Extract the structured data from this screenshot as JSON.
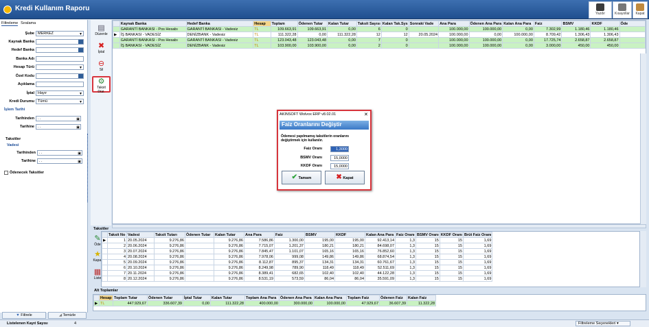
{
  "app": {
    "title": "Kredi Kullanım Raporu",
    "toolbar": {
      "print": "Yazdır",
      "favorites": "Kısayollar",
      "exit": "Kapat"
    }
  },
  "left": {
    "tabs": [
      "Filtreleme",
      "Sıralama"
    ],
    "fields": [
      {
        "label": "Şube",
        "value": "MERKEZ",
        "type": "dropdown"
      },
      {
        "label": "Kaynak Banka",
        "value": "",
        "type": "lookup"
      },
      {
        "label": "Hedef Banka",
        "value": "",
        "type": "lookup"
      },
      {
        "label": "Banka Adı",
        "value": "",
        "type": "text"
      },
      {
        "label": "Hesap Türü",
        "value": "",
        "type": "dropdown"
      },
      {
        "label": "Özel Kodu",
        "value": "",
        "type": "lookup"
      },
      {
        "label": "Açıklama",
        "value": "",
        "type": "text"
      },
      {
        "label": "İptal",
        "value": "Hayır",
        "type": "dropdown"
      },
      {
        "label": "Kredi Durumu",
        "value": "Tümü",
        "type": "dropdown"
      }
    ],
    "islem_tarihi": "İşlem Tarihi",
    "date1": [
      {
        "label": "Tarihinden",
        "value": " . ."
      },
      {
        "label": "Tarihine",
        "value": " . ."
      }
    ],
    "taksitler": "Taksitler",
    "vadesi": "Vadesi",
    "date2": [
      {
        "label": "Tarihinden",
        "value": " . ."
      },
      {
        "label": "Tarihine",
        "value": " . ."
      }
    ],
    "odenecek": "Ödenecek Taksitler",
    "filter_btn": "Filtrele",
    "clear_btn": "Temizle"
  },
  "vtools": [
    "Düzenle",
    "İptal",
    "Sil",
    "Taksit Düz."
  ],
  "grid": {
    "columns": [
      "Kaynak Banka",
      "Hedef Banka",
      "Hesap",
      "Toplam",
      "Ödenen Tutar",
      "Kalan Tutar",
      "Taksit Sayısı",
      "Kalan Tak.Sys",
      "Sonraki Vade",
      "Ana Para",
      "Ödenen Ana Para",
      "Kalan Ana Para",
      "Faiz",
      "BSMV",
      "KKDF",
      "Öde"
    ],
    "rows": [
      {
        "c": [
          "GARANTİ BANKASI - Pos Hesabı",
          "GARANTİ BANKASI - Vadesiz",
          "TL",
          "109.663,91",
          "109.663,91",
          "0,00",
          "6",
          "0",
          "",
          "100.000,00",
          "100.000,00",
          "0,00",
          "7.302,99",
          "1.180,46",
          "1.180,46",
          ""
        ],
        "green": true,
        "cur": false
      },
      {
        "c": [
          "İŞ BANKASI - VADESİZ",
          "DENİZBANK - Vadesiz",
          "TL",
          "111.322,28",
          "0,00",
          "111.322,28",
          "12",
          "12",
          "20.05.2024",
          "100.000,00",
          "0,00",
          "100.000,00",
          "8.709,42",
          "1.306,43",
          "1.306,43",
          ""
        ],
        "green": false,
        "cur": true
      },
      {
        "c": [
          "GARANTİ BANKASI - Pos Hesabı",
          "GARANTİ BANKASI - Vadesiz",
          "TL",
          "123.043,48",
          "123.043,48",
          "0,00",
          "7",
          "0",
          "",
          "100.000,00",
          "100.000,00",
          "0,00",
          "17.725,74",
          "2.658,87",
          "2.658,87",
          ""
        ],
        "green": true,
        "cur": false
      },
      {
        "c": [
          "İŞ BANKASI - VADESİZ",
          "DENİZBANK - Vadesiz",
          "TL",
          "103.900,00",
          "103.900,00",
          "0,00",
          "2",
          "0",
          "",
          "100.000,00",
          "100.000,00",
          "0,00",
          "3.000,00",
          "450,00",
          "450,00",
          ""
        ],
        "green": true,
        "cur": false
      }
    ]
  },
  "dialog": {
    "window_title": "AKINSOFT Wolvox ERP v8.02.01",
    "heading": "Faiz Oranlarını Değiştir",
    "desc1": "Ödemesi yapılmamış taksitlerin oranlarını",
    "desc2": "değiştirmek için kullanılır.",
    "fields": [
      {
        "label": "Faiz Oranı",
        "value": "1,3000"
      },
      {
        "label": "BSMV Oranı",
        "value": "15,0000"
      },
      {
        "label": "KKDF Oranı",
        "value": "15,0000"
      }
    ],
    "ok": "Tamam",
    "cancel": "Kapat"
  },
  "taksitler": {
    "label": "Taksitler",
    "tools": [
      "Öde",
      "Kapat",
      "Liste"
    ],
    "columns": [
      "Taksit No",
      "Vadesi",
      "Taksit Tutarı",
      "Ödenen Tutar",
      "Kalan Tutar",
      "Ana Para",
      "Faiz",
      "BSMV",
      "KKDF",
      "Kalan Ana Para",
      "Faiz Oranı",
      "BSMV Oranı",
      "KKDF Oranı",
      "Brüt Faiz Oranı"
    ],
    "rows": [
      [
        "1",
        "20.05.2024",
        "9.276,86",
        "",
        "9.276,86",
        "7.586,86",
        "1.300,00",
        "195,00",
        "195,00",
        "92.413,14",
        "1,3",
        "15",
        "15",
        "1,69"
      ],
      [
        "2",
        "20.06.2024",
        "9.276,86",
        "",
        "9.276,86",
        "7.715,07",
        "1.201,37",
        "180,21",
        "180,21",
        "84.698,07",
        "1,3",
        "15",
        "15",
        "1,69"
      ],
      [
        "3",
        "20.07.2024",
        "9.276,86",
        "",
        "9.276,86",
        "7.845,47",
        "1.101,07",
        "165,16",
        "165,16",
        "76.852,60",
        "1,3",
        "15",
        "15",
        "1,69"
      ],
      [
        "4",
        "20.08.2024",
        "9.276,86",
        "",
        "9.276,86",
        "7.978,06",
        "999,08",
        "149,86",
        "149,86",
        "68.874,54",
        "1,3",
        "15",
        "15",
        "1,69"
      ],
      [
        "5",
        "20.09.2024",
        "9.276,86",
        "",
        "9.276,86",
        "8.112,87",
        "895,37",
        "134,31",
        "134,31",
        "60.761,67",
        "1,3",
        "15",
        "15",
        "1,69"
      ],
      [
        "6",
        "20.10.2024",
        "9.276,86",
        "",
        "9.276,86",
        "8.249,98",
        "789,90",
        "118,49",
        "118,49",
        "52.511,69",
        "1,3",
        "15",
        "15",
        "1,69"
      ],
      [
        "7",
        "20.11.2024",
        "9.276,86",
        "",
        "9.276,86",
        "8.389,41",
        "682,65",
        "102,40",
        "102,40",
        "44.122,28",
        "1,3",
        "15",
        "15",
        "1,69"
      ],
      [
        "8",
        "20.12.2024",
        "9.276,86",
        "",
        "9.276,86",
        "8.531,19",
        "573,59",
        "86,04",
        "86,04",
        "35.591,09",
        "1,3",
        "15",
        "15",
        "1,69"
      ]
    ]
  },
  "alt": {
    "label": "Alt Toplamlar",
    "columns": [
      "Hesap",
      "Toplam Tutar",
      "Ödenen Tutar",
      "İptal Tutar",
      "Kalan Tutar",
      "Toplam Ana Para",
      "Ödenen Ana Para",
      "Kalan Ana Para",
      "Toplam Faiz",
      "Ödenen Faiz",
      "Kalan Faiz"
    ],
    "row": [
      "TL",
      "447.929,67",
      "336.607,39",
      "0,00",
      "111.322,28",
      "400.000,00",
      "300.000,00",
      "100.000,00",
      "47.929,67",
      "36.607,39",
      "11.322,28"
    ]
  },
  "status": {
    "label": "Listelenen Kayıt Sayısı",
    "count": "4",
    "filter_options": "Filtreleme Seçenekleri"
  }
}
